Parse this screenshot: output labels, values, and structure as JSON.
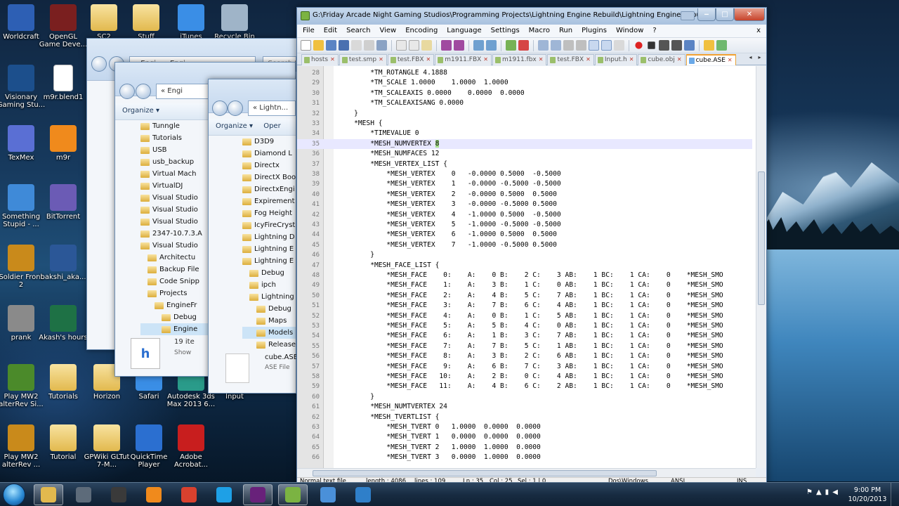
{
  "desktop": {
    "icons": [
      {
        "label": "Worldcraft",
        "icon": "worldcraft-icon",
        "color": "#2d5fb4"
      },
      {
        "label": "OpenGL Game Deve...",
        "icon": "book-icon",
        "color": "#7a1f1f"
      },
      {
        "label": "SC2",
        "icon": "folder-icon",
        "color": "#e2b94e"
      },
      {
        "label": "Stuff",
        "icon": "folder-icon",
        "color": "#e2b94e"
      },
      {
        "label": "iTunes",
        "icon": "itunes-icon",
        "color": "#3a8ee6"
      },
      {
        "label": "Recycle Bin",
        "icon": "recycle-bin-icon",
        "color": "#9fb4c8"
      },
      {
        "label": "Visionary Gaming Stu...",
        "icon": "visionary-icon",
        "color": "#1c4f8c"
      },
      {
        "label": "m9r.blend1",
        "icon": "file-icon",
        "color": "#ffffff"
      },
      {
        "label": "TexMex",
        "icon": "texmex-icon",
        "color": "#5a6fd4"
      },
      {
        "label": "m9r",
        "icon": "blender-icon",
        "color": "#f08a1c"
      },
      {
        "label": "Something Stupid - ...",
        "icon": "mp3-icon",
        "color": "#3f8ad8"
      },
      {
        "label": "BitTorrent",
        "icon": "bittorrent-icon",
        "color": "#6b5bb5"
      },
      {
        "label": "Soldier Front 2",
        "icon": "soldier-front-icon",
        "color": "#c98a1b"
      },
      {
        "label": "bakshi_aka...",
        "icon": "word-doc-icon",
        "color": "#2b5797"
      },
      {
        "label": "prank",
        "icon": "prank-icon",
        "color": "#8a8a8a"
      },
      {
        "label": "Akash's hours",
        "icon": "excel-doc-icon",
        "color": "#1e7145"
      },
      {
        "label": "Play MW2 alterRev Si...",
        "icon": "mw2-icon",
        "color": "#4b8a2a"
      },
      {
        "label": "Tutorials",
        "icon": "folder-icon",
        "color": "#e2b94e"
      },
      {
        "label": "Horizon",
        "icon": "folder-icon",
        "color": "#e2b94e"
      },
      {
        "label": "Safari",
        "icon": "safari-icon",
        "color": "#3a8ee6"
      },
      {
        "label": "Autodesk 3ds Max 2013 6...",
        "icon": "3dsmax-icon",
        "color": "#2a9b8a"
      },
      {
        "label": "Input",
        "icon": "folder-icon",
        "color": "#e2b94e"
      },
      {
        "label": "Play MW2 alterRev ...",
        "icon": "mw2-icon",
        "color": "#c98a1b"
      },
      {
        "label": "Tutorial",
        "icon": "folder-icon",
        "color": "#e2b94e"
      },
      {
        "label": "GPWiki GLTut 7-M...",
        "icon": "folder-icon",
        "color": "#e2b94e"
      },
      {
        "label": "QuickTime Player",
        "icon": "quicktime-icon",
        "color": "#2b6fd0"
      },
      {
        "label": "Adobe Acrobat...",
        "icon": "acrobat-icon",
        "color": "#c81e1e"
      }
    ]
  },
  "explorer1": {
    "address": "« Engi... › Engi..."
  },
  "explorer2": {
    "address": "« Engi",
    "organize": "Organize",
    "items": [
      "Tunngle",
      "Tutorials",
      "USB",
      "usb_backup",
      "Virtual Mach",
      "VirtualDJ",
      "Visual Studio",
      "Visual Studio",
      "Visual Studio",
      "2347-10.7.3.A",
      "Visual Studio",
      "Architectu",
      "Backup File",
      "Code Snipp",
      "Projects",
      "EngineFr",
      "Debug",
      "Engine"
    ],
    "count": "19 ite",
    "show": "Show"
  },
  "explorer3": {
    "address": "« Lightn...",
    "organize": "Organize",
    "open": "Oper",
    "items": [
      "D3D9",
      "Diamond L",
      "Directx",
      "DirectX Boo",
      "DirectxEngi",
      "Expirement",
      "Fog Height",
      "IcyFireCryst",
      "Lightning D",
      "Lightning E",
      "Lightning E",
      "Debug",
      "ipch",
      "Lightning",
      "Debug",
      "Maps",
      "Models",
      "Release"
    ],
    "file_name": "cube.ASE",
    "file_type": "ASE File"
  },
  "search_box": {
    "placeholder": "Search Fin"
  },
  "npp": {
    "title": "G:\\Friday Arcade Night Gaming Studios\\Programming Projects\\Lightning Engine  Rebuild\\Lightning Engine  Rebuild\\cube.ASE",
    "menu": [
      "File",
      "Edit",
      "Search",
      "View",
      "Encoding",
      "Language",
      "Settings",
      "Macro",
      "Run",
      "Plugins",
      "Window",
      "?"
    ],
    "menu_close": "x",
    "tabs": [
      {
        "label": "hosts",
        "active": false
      },
      {
        "label": "test.smp",
        "active": false
      },
      {
        "label": "test.FBX",
        "active": false
      },
      {
        "label": "m1911.FBX",
        "active": false
      },
      {
        "label": "m1911.fbx",
        "active": false
      },
      {
        "label": "test.FBX",
        "active": false
      },
      {
        "label": "Input.h",
        "active": false
      },
      {
        "label": "cube.obj",
        "active": false
      },
      {
        "label": "cube.ASE",
        "active": true
      }
    ],
    "lines": [
      {
        "n": "28",
        "text": "        *TM_ROTANGLE 4.1888"
      },
      {
        "n": "29",
        "text": "        *TM_SCALE 1.0000    1.0000  1.0000"
      },
      {
        "n": "30",
        "text": "        *TM_SCALEAXIS 0.0000    0.0000  0.0000"
      },
      {
        "n": "31",
        "text": "        *TM_SCALEAXISANG 0.0000"
      },
      {
        "n": "32",
        "text": "    }"
      },
      {
        "n": "33",
        "text": "    *MESH {"
      },
      {
        "n": "34",
        "text": "        *TIMEVALUE 0"
      },
      {
        "n": "35",
        "text": "        *MESH_NUMVERTEX ",
        "hl": "8",
        "current": true
      },
      {
        "n": "36",
        "text": "        *MESH_NUMFACES 12"
      },
      {
        "n": "37",
        "text": "        *MESH_VERTEX_LIST {"
      },
      {
        "n": "38",
        "text": "            *MESH_VERTEX    0   -0.0000 0.5000  -0.5000"
      },
      {
        "n": "39",
        "text": "            *MESH_VERTEX    1   -0.0000 -0.5000 -0.5000"
      },
      {
        "n": "40",
        "text": "            *MESH_VERTEX    2   -0.0000 0.5000  0.5000"
      },
      {
        "n": "41",
        "text": "            *MESH_VERTEX    3   -0.0000 -0.5000 0.5000"
      },
      {
        "n": "42",
        "text": "            *MESH_VERTEX    4   -1.0000 0.5000  -0.5000"
      },
      {
        "n": "43",
        "text": "            *MESH_VERTEX    5   -1.0000 -0.5000 -0.5000"
      },
      {
        "n": "44",
        "text": "            *MESH_VERTEX    6   -1.0000 0.5000  0.5000"
      },
      {
        "n": "45",
        "text": "            *MESH_VERTEX    7   -1.0000 -0.5000 0.5000"
      },
      {
        "n": "46",
        "text": "        }"
      },
      {
        "n": "47",
        "text": "        *MESH_FACE_LIST {"
      },
      {
        "n": "48",
        "text": "            *MESH_FACE    0:    A:    0 B:    2 C:    3 AB:    1 BC:    1 CA:    0    *MESH_SMO"
      },
      {
        "n": "49",
        "text": "            *MESH_FACE    1:    A:    3 B:    1 C:    0 AB:    1 BC:    1 CA:    0    *MESH_SMO"
      },
      {
        "n": "50",
        "text": "            *MESH_FACE    2:    A:    4 B:    5 C:    7 AB:    1 BC:    1 CA:    0    *MESH_SMO"
      },
      {
        "n": "51",
        "text": "            *MESH_FACE    3:    A:    7 B:    6 C:    4 AB:    1 BC:    1 CA:    0    *MESH_SMO"
      },
      {
        "n": "52",
        "text": "            *MESH_FACE    4:    A:    0 B:    1 C:    5 AB:    1 BC:    1 CA:    0    *MESH_SMO"
      },
      {
        "n": "53",
        "text": "            *MESH_FACE    5:    A:    5 B:    4 C:    0 AB:    1 BC:    1 CA:    0    *MESH_SMO"
      },
      {
        "n": "54",
        "text": "            *MESH_FACE    6:    A:    1 B:    3 C:    7 AB:    1 BC:    1 CA:    0    *MESH_SMO"
      },
      {
        "n": "55",
        "text": "            *MESH_FACE    7:    A:    7 B:    5 C:    1 AB:    1 BC:    1 CA:    0    *MESH_SMO"
      },
      {
        "n": "56",
        "text": "            *MESH_FACE    8:    A:    3 B:    2 C:    6 AB:    1 BC:    1 CA:    0    *MESH_SMO"
      },
      {
        "n": "57",
        "text": "            *MESH_FACE    9:    A:    6 B:    7 C:    3 AB:    1 BC:    1 CA:    0    *MESH_SMO"
      },
      {
        "n": "58",
        "text": "            *MESH_FACE   10:    A:    2 B:    0 C:    4 AB:    1 BC:    1 CA:    0    *MESH_SMO"
      },
      {
        "n": "59",
        "text": "            *MESH_FACE   11:    A:    4 B:    6 C:    2 AB:    1 BC:    1 CA:    0    *MESH_SMO"
      },
      {
        "n": "60",
        "text": "        }"
      },
      {
        "n": "61",
        "text": "        *MESH_NUMTVERTEX 24"
      },
      {
        "n": "62",
        "text": "        *MESH_TVERTLIST {"
      },
      {
        "n": "63",
        "text": "            *MESH_TVERT 0   1.0000  0.0000  0.0000"
      },
      {
        "n": "64",
        "text": "            *MESH_TVERT 1   0.0000  0.0000  0.0000"
      },
      {
        "n": "65",
        "text": "            *MESH_TVERT 2   1.0000  1.0000  0.0000"
      },
      {
        "n": "66",
        "text": "            *MESH_TVERT 3   0.0000  1.0000  0.0000"
      }
    ],
    "status": {
      "type": "Normal text file",
      "length": "length : 4086",
      "lines": "lines : 109",
      "ln": "Ln : 35",
      "col": "Col : 25",
      "sel": "Sel : 1 | 0",
      "eol": "Dos\\Windows",
      "encoding": "ANSI",
      "mode": "INS"
    }
  },
  "taskbar": {
    "items": [
      {
        "icon": "explorer-icon",
        "color": "#e2b94e",
        "active": true
      },
      {
        "icon": "steam-icon",
        "color": "#5d6b7a",
        "active": false
      },
      {
        "icon": "unity-icon",
        "color": "#3a3a3a",
        "active": false
      },
      {
        "icon": "blender-icon",
        "color": "#f08a1c",
        "active": false
      },
      {
        "icon": "chrome-icon",
        "color": "#d9412e",
        "active": false
      },
      {
        "icon": "skype-icon",
        "color": "#1ea0e6",
        "active": false
      },
      {
        "icon": "visual-studio-icon",
        "color": "#68217a",
        "active": true
      },
      {
        "icon": "notepad-plus-plus-icon",
        "color": "#7bb342",
        "active": true
      },
      {
        "icon": "paint-icon",
        "color": "#4a90d9",
        "active": false
      },
      {
        "icon": "network-globe-icon",
        "color": "#2f7fc9",
        "active": false
      }
    ],
    "time": "9:00 PM",
    "date": "10/20/2013"
  }
}
